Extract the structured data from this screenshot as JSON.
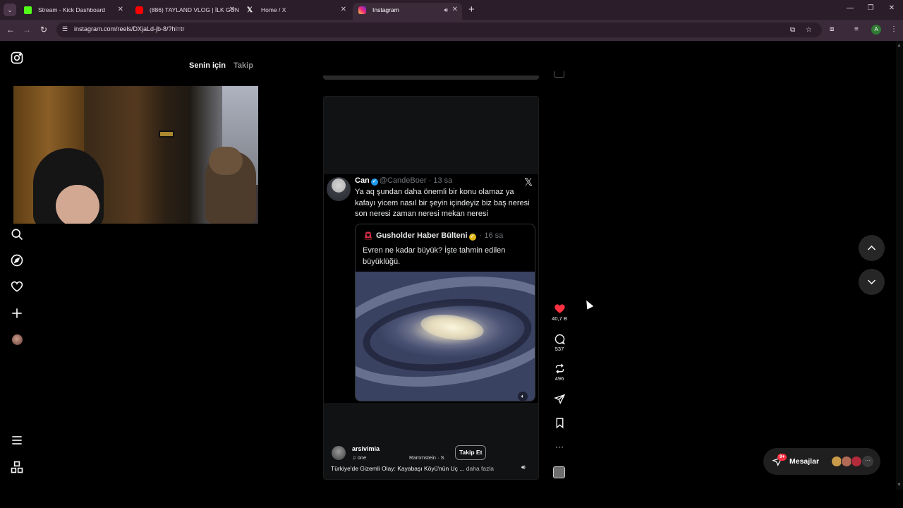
{
  "browser": {
    "tabs": [
      {
        "title": "Stream - Kick Dashboard",
        "favicon_color": "#53fc18",
        "active": false
      },
      {
        "title": "(886) TAYLAND VLOG | İLK GÜN",
        "favicon_color": "#ff0000",
        "active": false
      },
      {
        "title": "Home / X",
        "favicon_color": "#000000",
        "active": false
      },
      {
        "title": "Instagram",
        "favicon_color": "#e1306c",
        "active": true
      }
    ],
    "url": "instagram.com/reels/DXjaLd-jb-8/?hl=tr",
    "profile_initial": "A"
  },
  "sidebar": {
    "icons": [
      "instagram-logo-icon",
      "search-icon",
      "explore-icon",
      "heart-icon",
      "create-icon",
      "profile-avatar",
      "menu-icon",
      "more-apps-icon"
    ]
  },
  "feed_tabs": {
    "for_you": "Senin için",
    "following": "Takip"
  },
  "tweet": {
    "author_name": "Can",
    "author_handle": "@CandeBoer",
    "time": "13 sa",
    "text": "Ya aq şundan daha önemli bir konu olamaz ya kafayı yicem nasıl bir şeyin içindeyiz biz baş neresi son neresi zaman neresi mekan neresi",
    "quoted": {
      "author_name": "Gusholder Haber Bülteni",
      "time": "16 sa",
      "text": "Evren ne kadar büyük? İşte tahmin edilen büyüklüğü."
    }
  },
  "reel": {
    "username": "arsivimia",
    "audio": "one",
    "audio2": "Rammstein · S",
    "follow_label": "Takip Et",
    "caption": "Türkiye'de Gizemli Olay: Kayabaşı Köyü'nün Uç ...",
    "more_label": "daha fazla"
  },
  "actions": {
    "likes": "40,7 B",
    "comments": "537",
    "reposts": "496"
  },
  "messages": {
    "label": "Mesajlar",
    "badge": "9+"
  },
  "colors": {
    "like_red": "#ff3040",
    "verified_blue": "#1d9bf0",
    "verified_gold": "#e2b719",
    "chrome_frame": "#2b1d2a"
  }
}
